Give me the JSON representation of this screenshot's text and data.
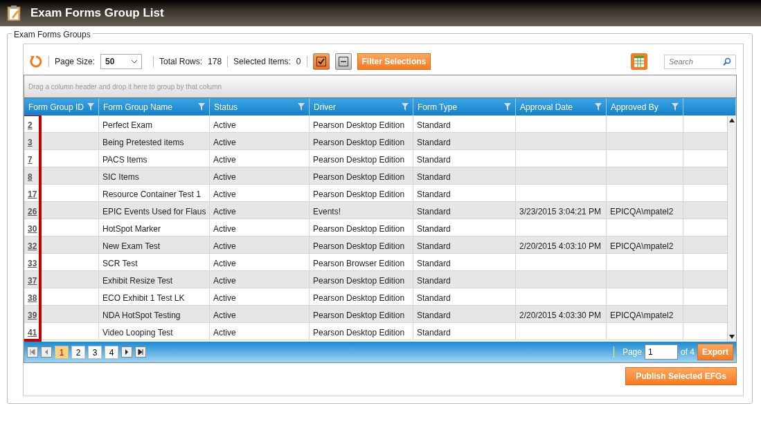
{
  "window": {
    "title": "Exam Forms Group List"
  },
  "group": {
    "legend": "Exam Forms Groups"
  },
  "toolbar": {
    "page_size_label": "Page Size:",
    "page_size": "50",
    "total_rows_label": "Total Rows:",
    "total_rows": "178",
    "selected_label": "Selected Items:",
    "selected_count": "0",
    "filter_button": "Filter Selections",
    "search": {
      "placeholder": "Search"
    }
  },
  "grid": {
    "group_hint": "Drag a column header and drop it here to group by that column",
    "columns": [
      "Form Group ID",
      "Form Group Name",
      "Status",
      "Driver",
      "Form Type",
      "Approval Date",
      "Approved By"
    ],
    "id_column_highlighted": true,
    "rows": [
      [
        "2",
        "Perfect Exam",
        "Active",
        "Pearson Desktop Edition",
        "Standard",
        "",
        ""
      ],
      [
        "3",
        "Being Pretested items",
        "Active",
        "Pearson Desktop Edition",
        "Standard",
        "",
        ""
      ],
      [
        "7",
        "PACS Items",
        "Active",
        "Pearson Desktop Edition",
        "Standard",
        "",
        ""
      ],
      [
        "8",
        "SIC Items",
        "Active",
        "Pearson Desktop Edition",
        "Standard",
        "",
        ""
      ],
      [
        "17",
        "Resource Container Test 1",
        "Active",
        "Pearson Desktop Edition",
        "Standard",
        "",
        ""
      ],
      [
        "26",
        "EPIC Events Used for Flaus",
        "Active",
        "Events!",
        "Standard",
        "3/23/2015 3:04:21 PM",
        "EPICQA\\mpatel2"
      ],
      [
        "30",
        "HotSpot Marker",
        "Active",
        "Pearson Desktop Edition",
        "Standard",
        "",
        ""
      ],
      [
        "32",
        "New Exam Test",
        "Active",
        "Pearson Desktop Edition",
        "Standard",
        "2/20/2015 4:03:10 PM",
        "EPICQA\\mpatel2"
      ],
      [
        "33",
        "SCR Test",
        "Active",
        "Pearson Browser Edition",
        "Standard",
        "",
        ""
      ],
      [
        "37",
        "Exhibit Resize Test",
        "Active",
        "Pearson Desktop Edition",
        "Standard",
        "",
        ""
      ],
      [
        "38",
        "ECO Exhibit 1 Test LK",
        "Active",
        "Pearson Desktop Edition",
        "Standard",
        "",
        ""
      ],
      [
        "39",
        "NDA HotSpot Testing",
        "Active",
        "Pearson Desktop Edition",
        "Standard",
        "2/20/2015 4:03:30 PM",
        "EPICQA\\mpatel2"
      ],
      [
        "41",
        "Video Looping Test",
        "Active",
        "Pearson Desktop Edition",
        "Standard",
        "",
        ""
      ]
    ],
    "pager": {
      "pages": [
        {
          "label": "1",
          "selected": true
        },
        {
          "label": "2",
          "selected": false
        },
        {
          "label": "3",
          "selected": false
        },
        {
          "label": "4",
          "selected": false
        }
      ],
      "page_label": "Page",
      "page_value": "1",
      "of_label": "of 4",
      "export_button": "Export"
    }
  },
  "publish_button": "Publish Selected EFGs"
}
